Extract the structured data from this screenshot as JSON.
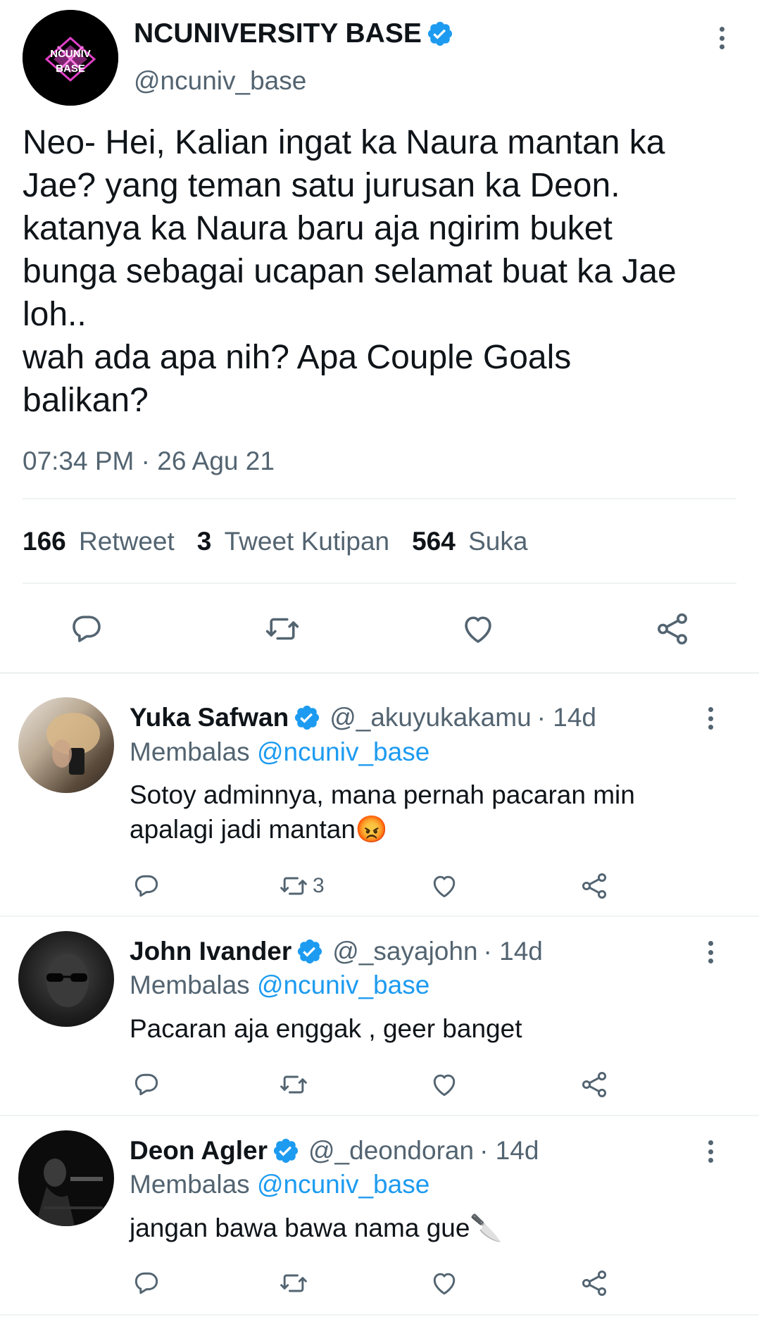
{
  "tweet": {
    "author_name": "NCUNIVERSITY BASE",
    "author_handle": "@ncuniv_base",
    "avatar_logo_text": "NCUNIV BASE",
    "text_lines": [
      "Neo- Hei, Kalian ingat ka Naura mantan ka",
      "Jae? yang teman satu jurusan ka Deon.",
      "katanya ka Naura baru aja ngirim buket",
      "bunga sebagai ucapan selamat buat ka Jae",
      "loh..",
      "wah ada apa nih? Apa Couple Goals",
      "balikan?"
    ],
    "timestamp": "07:34 PM · 26 Agu 21",
    "stats": {
      "retweets_count": "166",
      "retweets_label": "Retweet",
      "quotes_count": "3",
      "quotes_label": "Tweet Kutipan",
      "likes_count": "564",
      "likes_label": "Suka"
    },
    "actions": [
      "reply-icon",
      "retweet-icon",
      "like-icon",
      "share-icon"
    ]
  },
  "replies": [
    {
      "name": "Yuka Safwan",
      "handle": "@_akuyukakamu",
      "time": "· 14d",
      "replying_prefix": "Membalas",
      "replying_to": "@ncuniv_base",
      "text_line1": "Sotoy adminnya, mana pernah pacaran min",
      "text_line2": "apalagi jadi mantan",
      "emoji": "😡",
      "retweet_count": "3"
    },
    {
      "name": "John Ivander",
      "handle": "@_sayajohn",
      "time": "· 14d",
      "replying_prefix": "Membalas",
      "replying_to": "@ncuniv_base",
      "text_line1": "Pacaran aja enggak , geer banget"
    },
    {
      "name": "Deon Agler",
      "handle": "@_deondoran",
      "time": "· 14d",
      "replying_prefix": "Membalas",
      "replying_to": "@ncuniv_base",
      "text_line1": "jangan bawa bawa nama gue",
      "emoji": "🔪"
    }
  ],
  "colors": {
    "accent": "#1d9bf0",
    "muted": "#536471",
    "divider": "#eff3f4",
    "logo_pink": "#e040c8"
  }
}
